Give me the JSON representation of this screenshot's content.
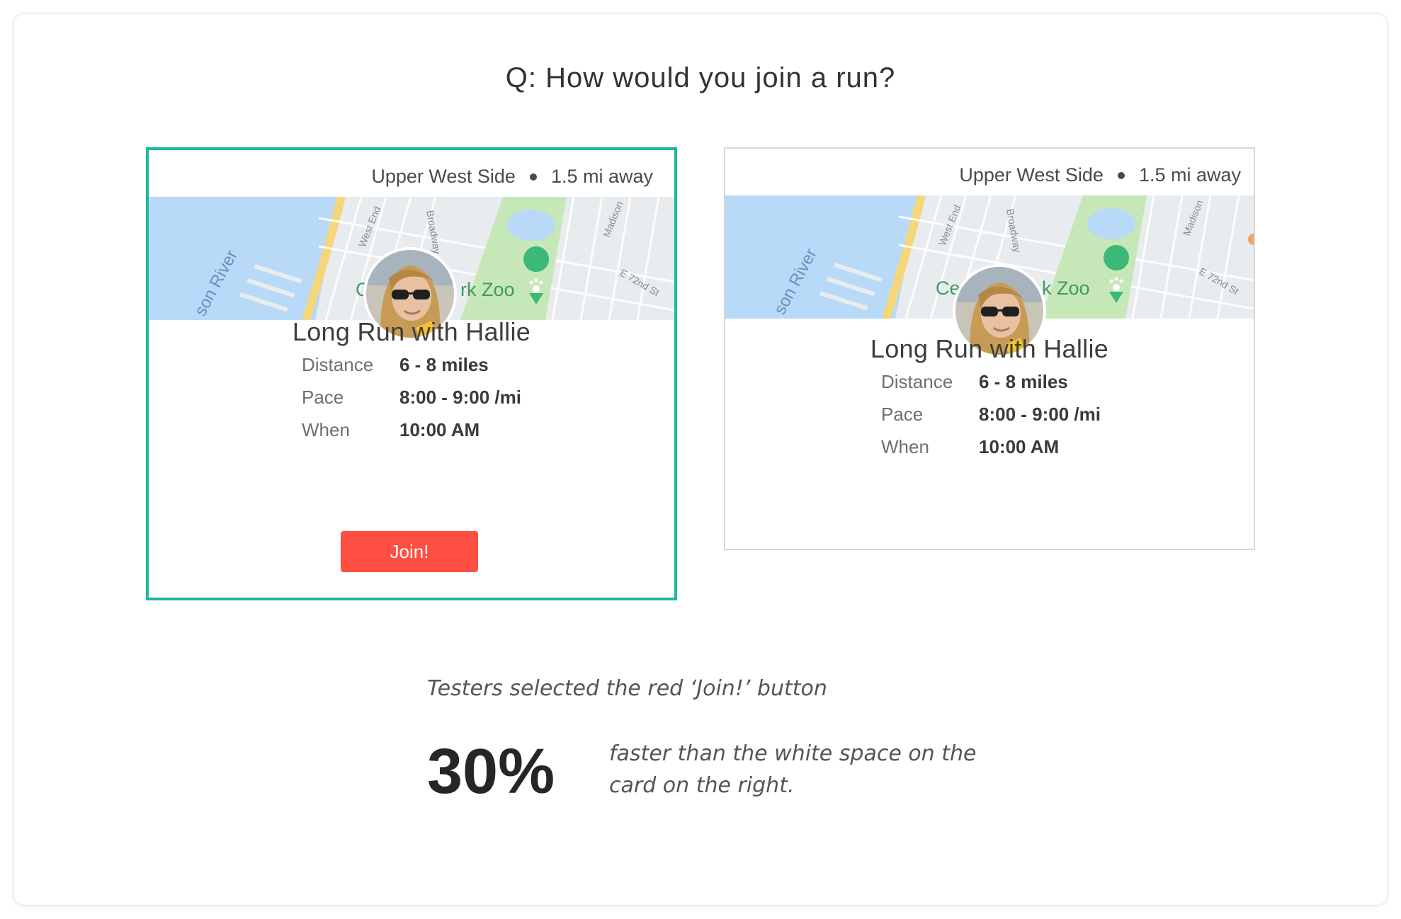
{
  "question": "Q: How would you join a run?",
  "cards": {
    "left": {
      "location": "Upper West Side",
      "distance_away": "1.5 mi away",
      "title": "Long Run with Hallie",
      "rows": [
        {
          "label": "Distance",
          "value": "6 - 8 miles"
        },
        {
          "label": "Pace",
          "value": "8:00 - 9:00 /mi"
        },
        {
          "label": "When",
          "value": "10:00 AM"
        }
      ],
      "join_label": "Join!",
      "map": {
        "river_label": "son River",
        "street_labels": [
          "West End",
          "Broadway",
          "Madison",
          "E 72nd St"
        ],
        "zoo_label_fragments": [
          "C",
          "rk Zoo"
        ]
      }
    },
    "right": {
      "location": "Upper West Side",
      "distance_away": "1.5 mi away",
      "title": "Long Run with Hallie",
      "rows": [
        {
          "label": "Distance",
          "value": "6 - 8 miles"
        },
        {
          "label": "Pace",
          "value": "8:00 - 9:00 /mi"
        },
        {
          "label": "When",
          "value": "10:00 AM"
        }
      ],
      "map": {
        "river_label": "son River",
        "street_labels": [
          "West End",
          "Broadway",
          "Madison",
          "E 72nd St"
        ],
        "zoo_label_fragments": [
          "Ce",
          "k Zoo"
        ]
      }
    }
  },
  "result": {
    "caption": "Testers selected the red ‘Join!’ button",
    "stat": "30%",
    "stat_description": "faster than the white space on the card on the right."
  },
  "colors": {
    "selected_border": "#1ab9a0",
    "join_button": "#ff4e42",
    "water": "#b8d9f7",
    "park": "#c6e7b8",
    "road_yellow": "#f5d67a",
    "zoo_pin": "#3cb878"
  },
  "icons": {
    "location_separator": "dot-icon",
    "zoo_pin": "paw-pin-icon"
  }
}
